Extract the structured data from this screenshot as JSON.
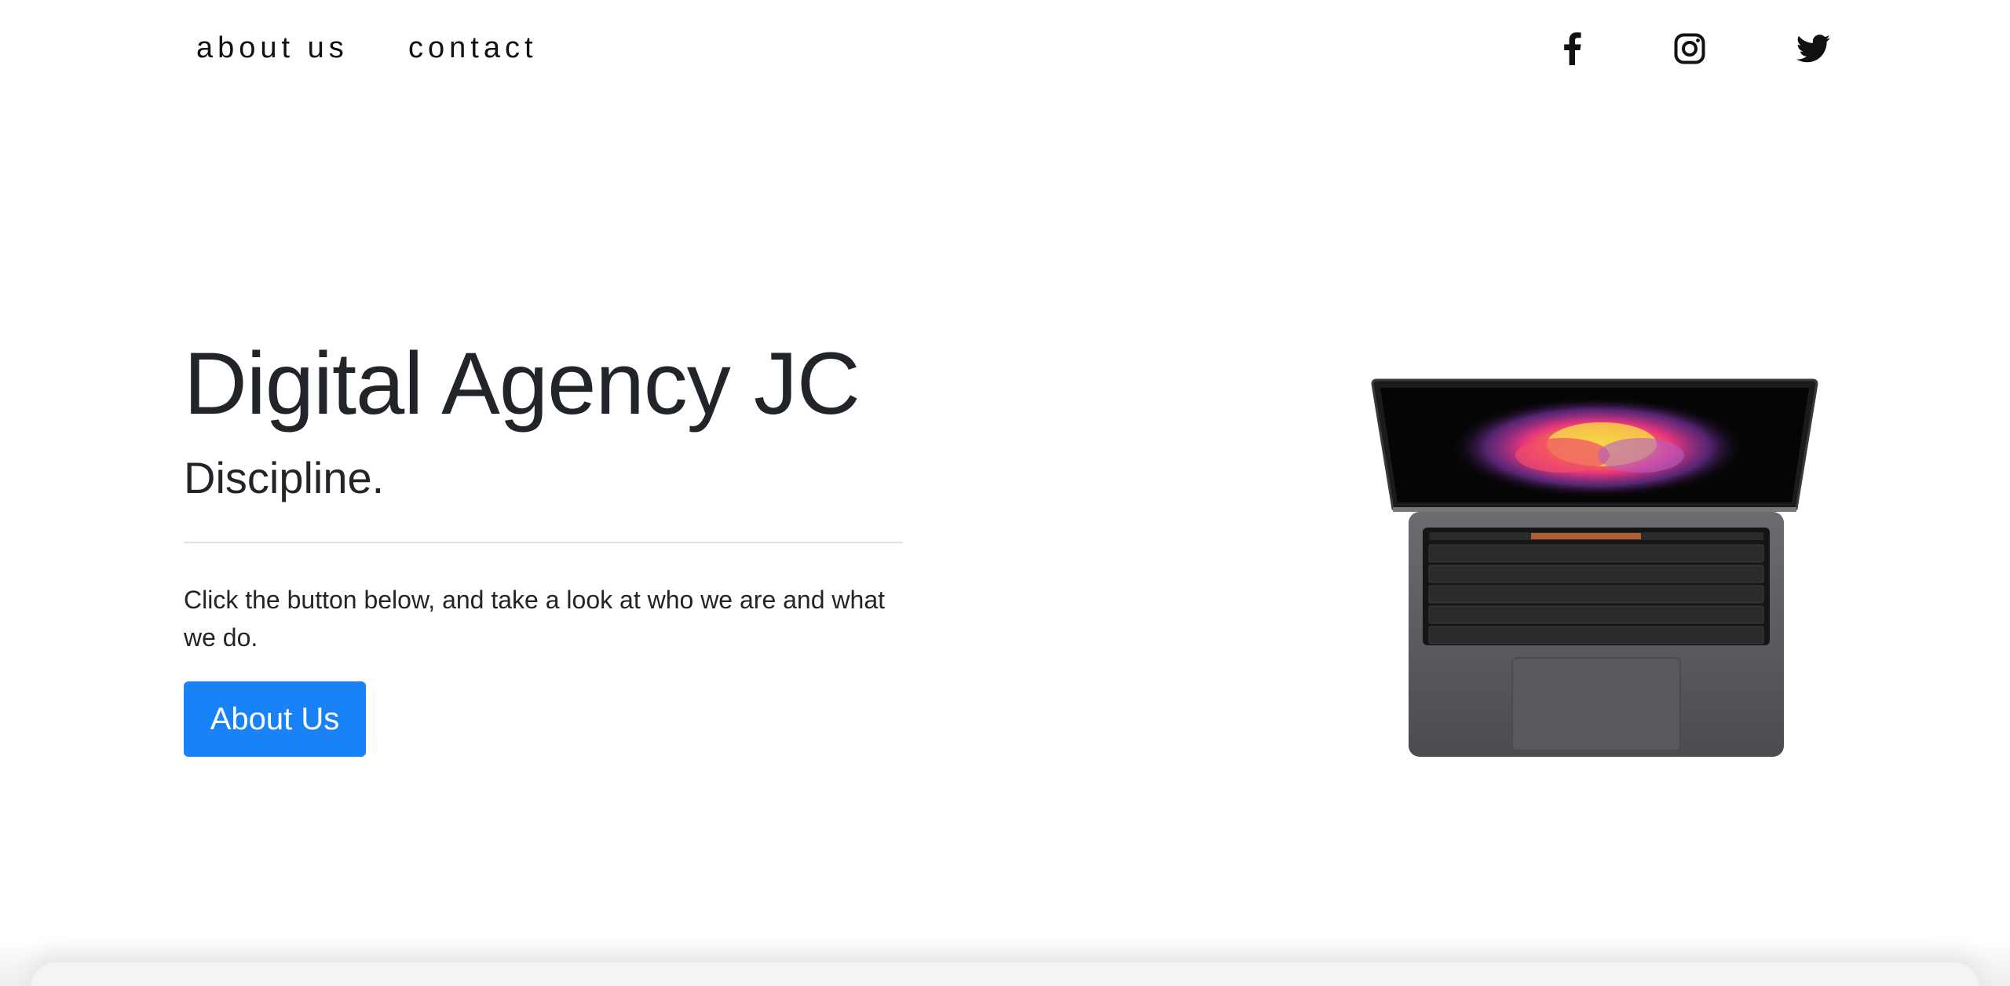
{
  "nav": {
    "links": [
      {
        "label": "about us"
      },
      {
        "label": "contact"
      }
    ],
    "social": [
      {
        "icon": "facebook-icon"
      },
      {
        "icon": "instagram-icon"
      },
      {
        "icon": "twitter-icon"
      }
    ]
  },
  "hero": {
    "title": "Digital Agency JC",
    "subtitle": "Discipline.",
    "text": "Click the button below, and take a look at who we are and what we do.",
    "button_label": "About Us"
  },
  "colors": {
    "primary_button": "#1a82f7",
    "text": "#212529"
  }
}
